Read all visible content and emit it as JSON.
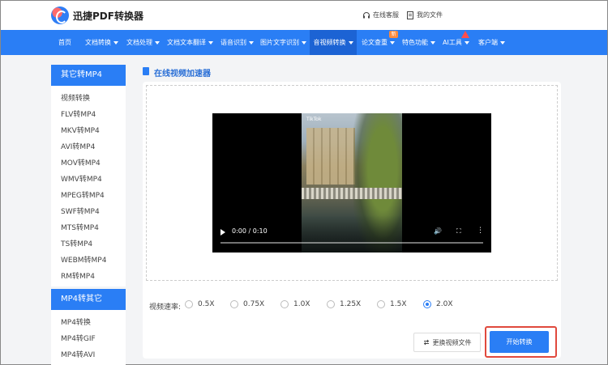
{
  "header": {
    "brand": "迅捷PDF转换器",
    "links": [
      {
        "label": "在线客服",
        "icon": "headset-icon"
      },
      {
        "label": "我的文件",
        "icon": "document-icon"
      }
    ]
  },
  "nav": {
    "items": [
      {
        "label": "首页",
        "caret": false
      },
      {
        "label": "文档转换",
        "caret": true
      },
      {
        "label": "文档处理",
        "caret": true
      },
      {
        "label": "文档文本翻译",
        "caret": true
      },
      {
        "label": "语音识别",
        "caret": true
      },
      {
        "label": "图片文字识别",
        "caret": true
      },
      {
        "label": "音视频转换",
        "caret": true,
        "active": true
      },
      {
        "label": "论文查重",
        "caret": true
      },
      {
        "label": "特色功能",
        "caret": true
      },
      {
        "label": "AI工具",
        "caret": true
      },
      {
        "label": "客户端",
        "caret": true
      }
    ],
    "new_badge": "新"
  },
  "sidebar": {
    "section1_title": "其它转MP4",
    "section1_items": [
      "视频转换",
      "FLV转MP4",
      "MKV转MP4",
      "AVI转MP4",
      "MOV转MP4",
      "WMV转MP4",
      "MPEG转MP4",
      "SWF转MP4",
      "MTS转MP4",
      "TS转MP4",
      "WEBM转MP4",
      "RM转MP4"
    ],
    "section2_title": "MP4转其它",
    "section2_items": [
      "MP4转换",
      "MP4转GIF",
      "MP4转AVI"
    ]
  },
  "main": {
    "title": "在线视频加速器",
    "video": {
      "watermark": "TikTok",
      "time": "0:00 / 0:10",
      "progress": 0
    },
    "speed": {
      "label": "视频速率:",
      "options": [
        "0.5X",
        "0.75X",
        "1.0X",
        "1.25X",
        "1.5X",
        "2.0X"
      ],
      "selected": "2.0X"
    },
    "replace_button": "更换视频文件",
    "start_button": "开始转换"
  },
  "colors": {
    "accent": "#2a7ef5",
    "nav_active": "#1c63d4",
    "highlight_outline": "#e0493d"
  }
}
